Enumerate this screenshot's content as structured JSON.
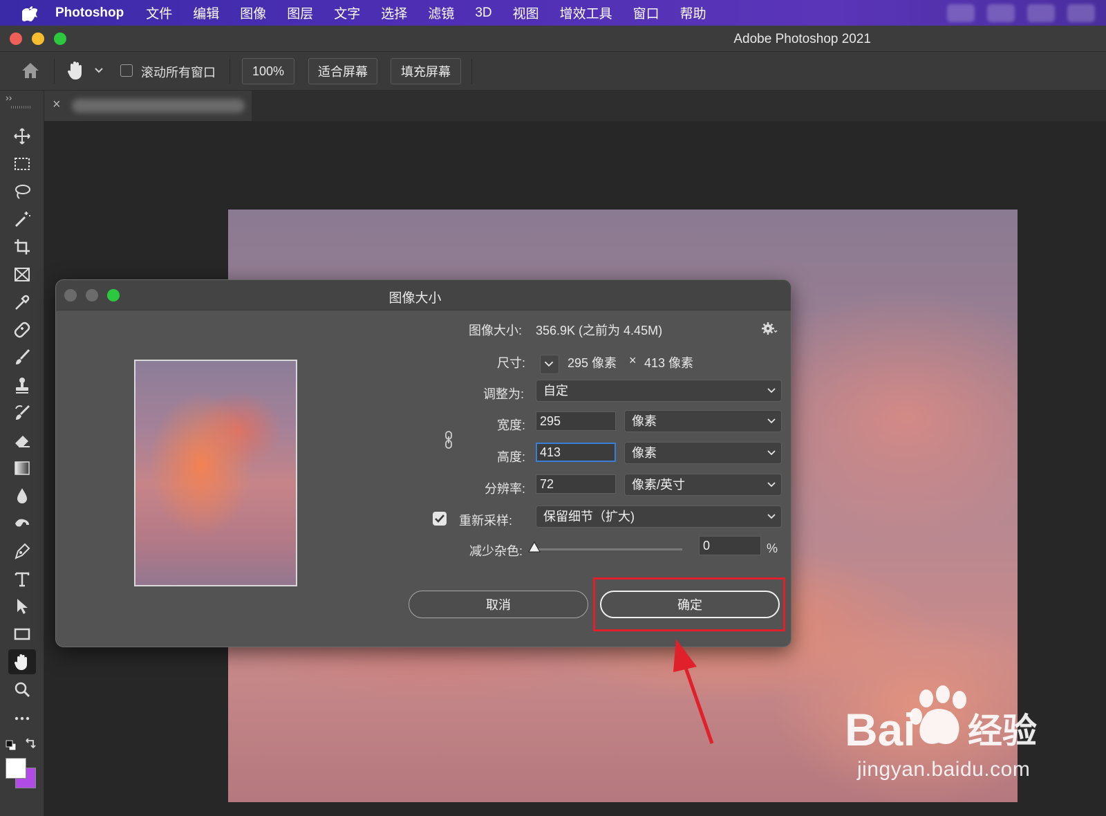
{
  "menubar": {
    "app_name": "Photoshop",
    "items": [
      "文件",
      "编辑",
      "图像",
      "图层",
      "文字",
      "选择",
      "滤镜",
      "3D",
      "视图",
      "增效工具",
      "窗口",
      "帮助"
    ]
  },
  "window": {
    "title": "Adobe Photoshop 2021"
  },
  "options_bar": {
    "scroll_all_label": "滚动所有窗口",
    "zoom_button": "100%",
    "fit_screen_button": "适合屏幕",
    "fill_screen_button": "填充屏幕"
  },
  "tools": [
    "move-tool",
    "marquee-tool",
    "lasso-tool",
    "magic-wand-tool",
    "crop-tool",
    "frame-tool",
    "eyedropper-tool",
    "healing-brush-tool",
    "brush-tool",
    "clone-stamp-tool",
    "history-brush-tool",
    "eraser-tool",
    "gradient-tool",
    "blur-tool",
    "smudge-tool",
    "pen-tool",
    "type-tool",
    "path-selection-tool",
    "rectangle-tool",
    "hand-tool",
    "zoom-tool",
    "more-tools"
  ],
  "colors": {
    "foreground": "#ffffff",
    "background": "#b14be6",
    "highlight": "#e0202a",
    "focus": "#3a7fd6"
  },
  "dialog": {
    "title": "图像大小",
    "image_size_label": "图像大小:",
    "image_size_value": "356.9K (之前为 4.45M)",
    "dimensions_label": "尺寸:",
    "dimensions_width": "295 像素",
    "dimensions_sep": "×",
    "dimensions_height": "413 像素",
    "fit_to_label": "调整为:",
    "fit_to_value": "自定",
    "width_label": "宽度:",
    "width_value": "295",
    "width_unit": "像素",
    "height_label": "高度:",
    "height_value": "413",
    "height_unit": "像素",
    "resolution_label": "分辨率:",
    "resolution_value": "72",
    "resolution_unit": "像素/英寸",
    "resample_label": "重新采样:",
    "resample_checked": true,
    "resample_value": "保留细节（扩大)",
    "noise_label": "减少杂色:",
    "noise_value": "0",
    "noise_unit": "%",
    "cancel_button": "取消",
    "ok_button": "确定"
  },
  "watermark": {
    "brand": "Bai",
    "brand_cn": "经验",
    "url": "jingyan.baidu.com"
  }
}
